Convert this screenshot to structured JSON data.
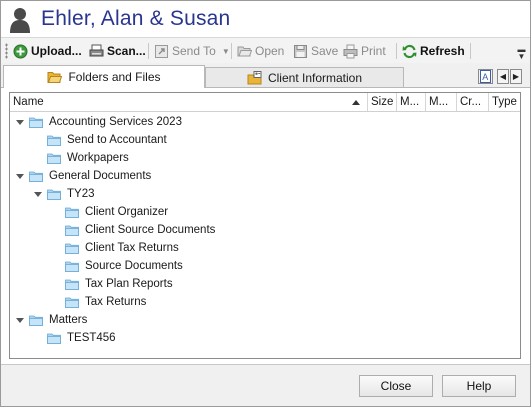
{
  "window": {
    "title": "Ehler, Alan & Susan",
    "accent": "#2a3590"
  },
  "toolbar": {
    "upload": "Upload...",
    "scan": "Scan...",
    "send_to": "Send To",
    "open": "Open",
    "save": "Save",
    "print": "Print",
    "refresh": "Refresh"
  },
  "tabs": [
    {
      "label": "Folders and Files",
      "active": true
    },
    {
      "label": "Client Information",
      "active": false
    }
  ],
  "grid": {
    "columns": [
      "Name",
      "Size",
      "M...",
      "M...",
      "Cr...",
      "Type"
    ],
    "rows": [
      {
        "label": "Accounting Services 2023",
        "level": 0,
        "expanded": true
      },
      {
        "label": "Send to Accountant",
        "level": 1,
        "expanded": false
      },
      {
        "label": "Workpapers",
        "level": 1,
        "expanded": false
      },
      {
        "label": "General Documents",
        "level": 0,
        "expanded": true
      },
      {
        "label": "TY23",
        "level": 1,
        "expanded": true
      },
      {
        "label": "Client Organizer",
        "level": 2,
        "expanded": false
      },
      {
        "label": "Client Source Documents",
        "level": 2,
        "expanded": false
      },
      {
        "label": "Client Tax Returns",
        "level": 2,
        "expanded": false
      },
      {
        "label": "Source Documents",
        "level": 2,
        "expanded": false
      },
      {
        "label": "Tax Plan Reports",
        "level": 2,
        "expanded": false
      },
      {
        "label": "Tax Returns",
        "level": 2,
        "expanded": false
      },
      {
        "label": "Matters",
        "level": 0,
        "expanded": true
      },
      {
        "label": "TEST456",
        "level": 1,
        "expanded": false
      }
    ]
  },
  "footer": {
    "close": "Close",
    "help": "Help"
  }
}
